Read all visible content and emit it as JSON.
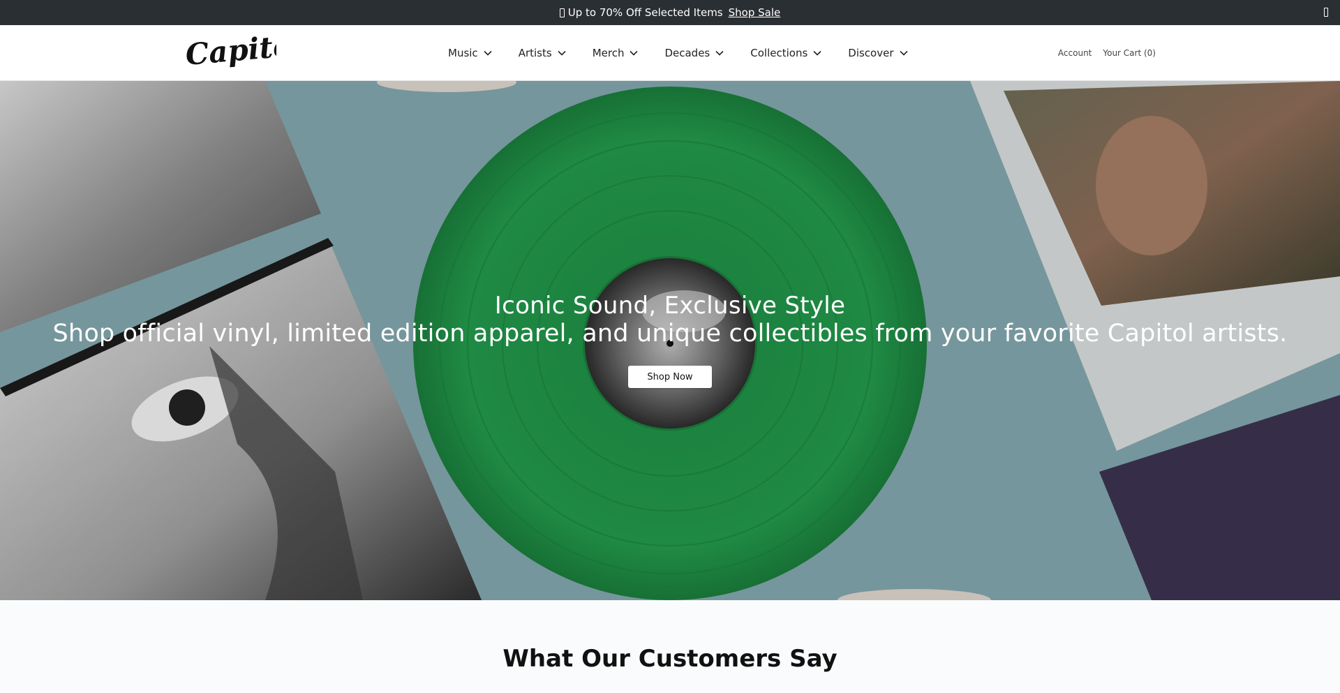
{
  "announcement": {
    "text": "Up to 70% Off Selected Items",
    "link": "Shop Sale"
  },
  "header": {
    "logo_text": "Capitol",
    "nav": [
      {
        "label": "Music"
      },
      {
        "label": "Artists"
      },
      {
        "label": "Merch"
      },
      {
        "label": "Decades"
      },
      {
        "label": "Collections"
      },
      {
        "label": "Discover"
      }
    ],
    "account_label": "Account",
    "cart_label": "Your Cart (0)"
  },
  "hero": {
    "title": "Iconic Sound, Exclusive Style",
    "subtitle": "Shop official vinyl, limited edition apparel, and unique collectibles from your favorite Capitol artists.",
    "cta": "Shop Now"
  },
  "testimonials": {
    "title": "What Our Customers Say"
  },
  "colors": {
    "announce_bg": "#2a2f33",
    "vinyl_green": "#1f8f45",
    "hero_bg": "#7fa2a8"
  }
}
